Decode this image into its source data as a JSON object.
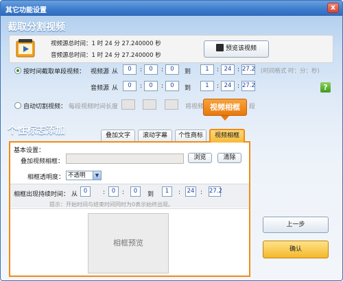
{
  "window": {
    "title": "其它功能设置",
    "close_glyph": "x"
  },
  "section1": {
    "title": "截取分割视频",
    "video_total": "视频源总时间：1  时 24  分 27.240000 秒",
    "audio_total": "音频源总时间：1  时 24  分 27.240000 秒",
    "preview_button": "预览该视频",
    "mode_single": {
      "label": "按时间截取单段视频：",
      "video_label": "视频源",
      "audio_label": "音频源",
      "from": "从",
      "to": "到",
      "video_from": [
        "0",
        "0",
        "0"
      ],
      "video_to": [
        "1",
        "24",
        "27.2"
      ],
      "audio_from": [
        "0",
        "0",
        "0"
      ],
      "audio_to": [
        "1",
        "24",
        "27.2"
      ],
      "time_hint": "(时间格式 时：分：秒)"
    },
    "mode_auto": {
      "label": "自动切割视频：",
      "length_label": "每段视频时间长度",
      "trailing_text": "将视频",
      "trailing_text2": "段"
    },
    "help_glyph": "?",
    "colon": ":"
  },
  "section2": {
    "title": "个性标志添加",
    "tabs": [
      "叠加文字",
      "滚动字幕",
      "个性商标",
      "视频相框"
    ],
    "active_tab_index": 3,
    "tooltip": "视频相框",
    "basic_settings": "基本设置：",
    "frame_label": "叠加视频相框：",
    "browse_button": "浏览",
    "clear_button": "清除",
    "opacity_label": "相框透明度：",
    "opacity_value": "不透明",
    "duration_label": "相框出现持续时间：",
    "from": "从",
    "to": "到",
    "dur_from": [
      "0",
      "0",
      "0"
    ],
    "dur_to": [
      "1",
      "24",
      "27.2"
    ],
    "duration_hint": "提示：开始时间与结束时间同时为0表示始终出现。",
    "preview_box": "相框预览"
  },
  "footer": {
    "prev_button": "上一步",
    "confirm_button": "确认"
  },
  "colors": {
    "accent_orange": "#f08a12",
    "title_blue": "#3f7fcf"
  }
}
